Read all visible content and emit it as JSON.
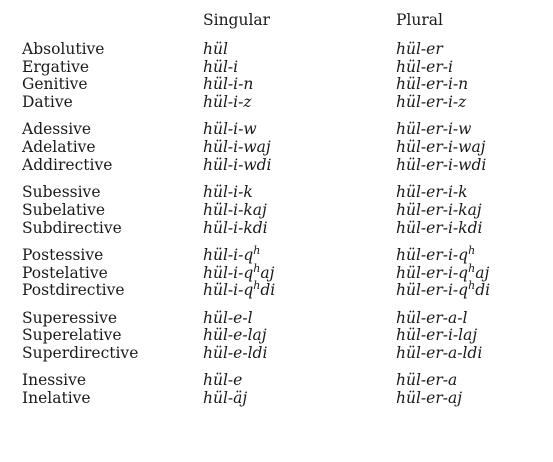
{
  "header": {
    "singular": "Singular",
    "plural": "Plural"
  },
  "groups": [
    {
      "rows": [
        {
          "case": "Absolutive",
          "sg": [
            "hül"
          ],
          "pl": [
            "hül-er"
          ]
        },
        {
          "case": "Ergative",
          "sg": [
            "hül-i"
          ],
          "pl": [
            "hül-er-i"
          ]
        },
        {
          "case": "Genitive",
          "sg": [
            "hül-i-n"
          ],
          "pl": [
            "hül-er-i-n"
          ]
        },
        {
          "case": "Dative",
          "sg": [
            "hül-i-z"
          ],
          "pl": [
            "hül-er-i-z"
          ]
        }
      ]
    },
    {
      "rows": [
        {
          "case": "Adessive",
          "sg": [
            "hül-i-w"
          ],
          "pl": [
            "hül-er-i-w"
          ]
        },
        {
          "case": "Adelative",
          "sg": [
            "hül-i-waj"
          ],
          "pl": [
            "hül-er-i-waj"
          ]
        },
        {
          "case": "Addirective",
          "sg": [
            "hül-i-wdi"
          ],
          "pl": [
            "hül-er-i-wdi"
          ]
        }
      ]
    },
    {
      "rows": [
        {
          "case": "Subessive",
          "sg": [
            "hül-i-k"
          ],
          "pl": [
            "hül-er-i-k"
          ]
        },
        {
          "case": "Subelative",
          "sg": [
            "hül-i-kaj"
          ],
          "pl": [
            "hül-er-i-kaj"
          ]
        },
        {
          "case": "Subdirective",
          "sg": [
            "hül-i-kdi"
          ],
          "pl": [
            "hül-er-i-kdi"
          ]
        }
      ]
    },
    {
      "rows": [
        {
          "case": "Postessive",
          "sg": [
            "hül-i-q",
            "h",
            ""
          ],
          "pl": [
            "hül-er-i-q",
            "h",
            ""
          ]
        },
        {
          "case": "Postelative",
          "sg": [
            "hül-i-q",
            "h",
            "aj"
          ],
          "pl": [
            "hül-er-i-q",
            "h",
            "aj"
          ]
        },
        {
          "case": "Postdirective",
          "sg": [
            "hül-i-q",
            "h",
            "di"
          ],
          "pl": [
            "hül-er-i-q",
            "h",
            "di"
          ]
        }
      ]
    },
    {
      "rows": [
        {
          "case": "Superessive",
          "sg": [
            "hül-e-l"
          ],
          "pl": [
            "hül-er-a-l"
          ]
        },
        {
          "case": "Superelative",
          "sg": [
            "hül-e-laj"
          ],
          "pl": [
            "hül-er-i-laj"
          ]
        },
        {
          "case": "Superdirective",
          "sg": [
            "hül-e-ldi"
          ],
          "pl": [
            "hül-er-a-ldi"
          ]
        }
      ]
    },
    {
      "rows": [
        {
          "case": "Inessive",
          "sg": [
            "hül-e"
          ],
          "pl": [
            "hül-er-a"
          ]
        },
        {
          "case": "Inelative",
          "sg": [
            "hül-äj"
          ],
          "pl": [
            "hül-er-aj"
          ]
        }
      ]
    }
  ]
}
